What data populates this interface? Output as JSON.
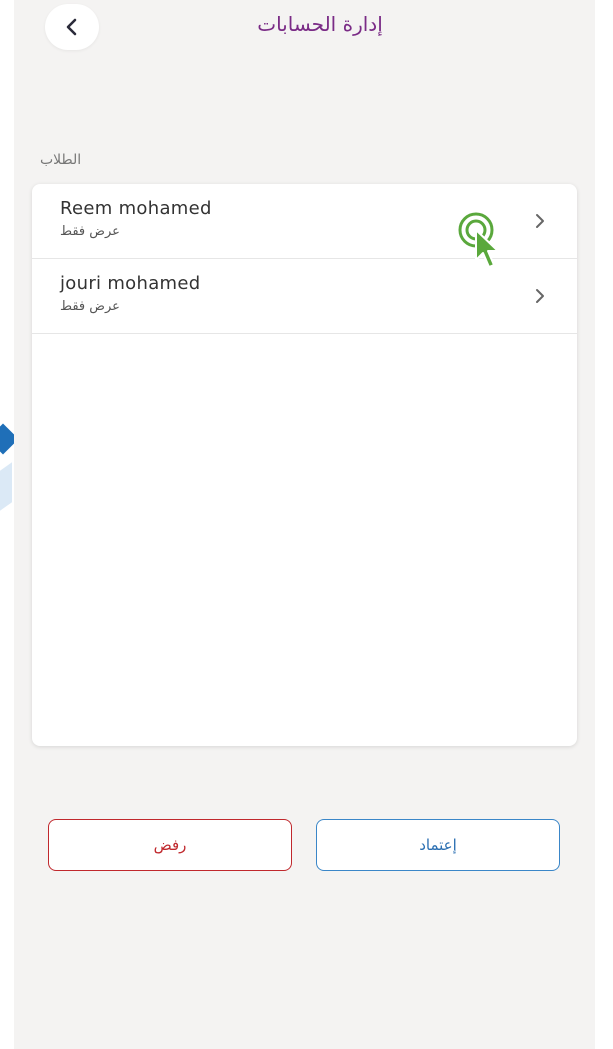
{
  "header": {
    "title": "إدارة الحسابات",
    "back_icon": "chevron-left-icon"
  },
  "section": {
    "label": "الطلاب"
  },
  "students": [
    {
      "name": "Reem mohamed",
      "permission": "عرض فقط"
    },
    {
      "name": "jouri mohamed",
      "permission": "عرض فقط"
    }
  ],
  "actions": {
    "reject_label": "رفض",
    "approve_label": "إعتماد"
  },
  "colors": {
    "title": "#7a2b86",
    "reject": "#c0282d",
    "approve": "#3a86c8",
    "cursor": "#5aa83c"
  }
}
